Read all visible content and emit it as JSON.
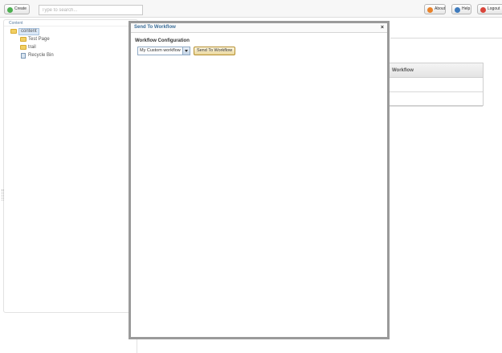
{
  "toolbar": {
    "create_label": "Create",
    "search_placeholder": "Type to search...",
    "about_label": "About",
    "help_label": "Help",
    "logout_label": "Logout"
  },
  "tree": {
    "header": "Content",
    "items": [
      {
        "label": "content",
        "icon": "folder-icon"
      },
      {
        "label": "Test Page",
        "icon": "folder-icon"
      },
      {
        "label": "trail",
        "icon": "folder-icon"
      },
      {
        "label": "Recycle Bin",
        "icon": "recycle-bin-icon"
      }
    ]
  },
  "background_table": {
    "header": "Workflow"
  },
  "modal": {
    "title": "Send To Workflow",
    "close_glyph": "×",
    "section_label": "Workflow Configuration",
    "select_value": "My Custom workflow",
    "send_button": "Send To Workflow"
  }
}
